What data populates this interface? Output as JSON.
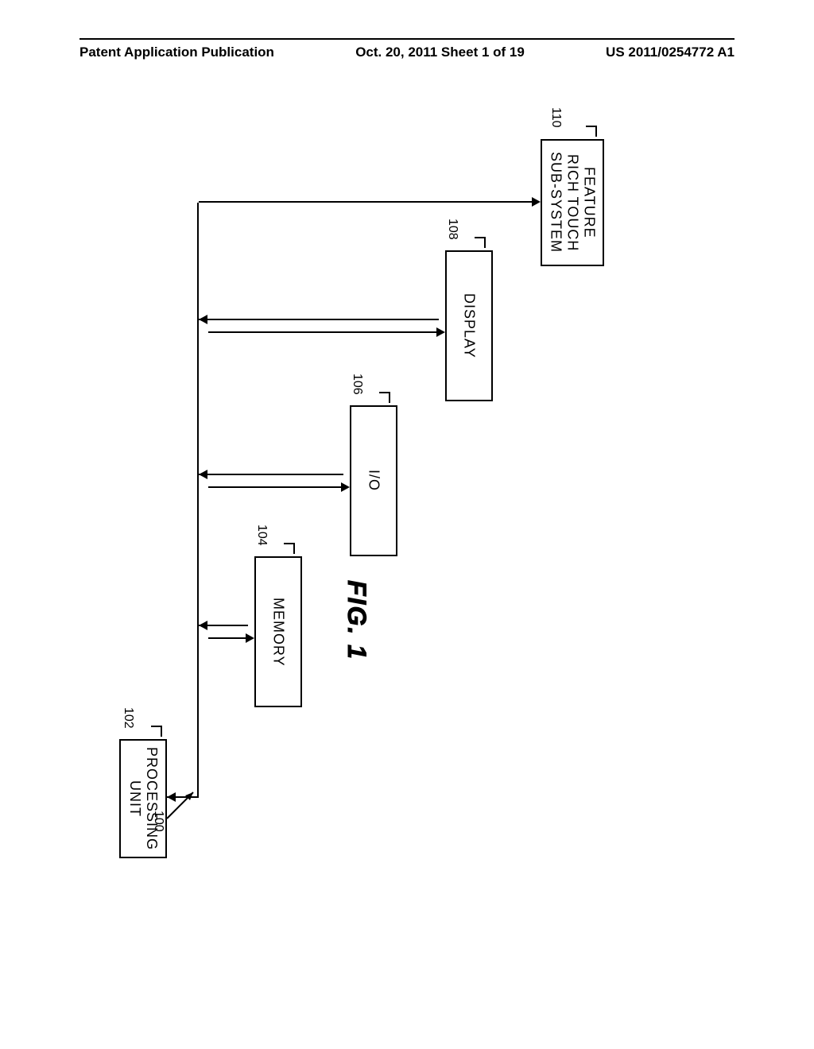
{
  "header": {
    "left": "Patent Application Publication",
    "center": "Oct. 20, 2011  Sheet 1 of 19",
    "right": "US 2011/0254772 A1"
  },
  "boxes": {
    "processing": {
      "label": "PROCESSING\nUNIT",
      "ref": "102"
    },
    "memory": {
      "label": "MEMORY",
      "ref": "104"
    },
    "io": {
      "label": "I/O",
      "ref": "106"
    },
    "display": {
      "label": "DISPLAY",
      "ref": "108"
    },
    "touch": {
      "label": "FEATURE\nRICH TOUCH\nSUB-SYSTEM",
      "ref": "110"
    }
  },
  "system_ref": "100",
  "figure_label": "FIG. 1"
}
